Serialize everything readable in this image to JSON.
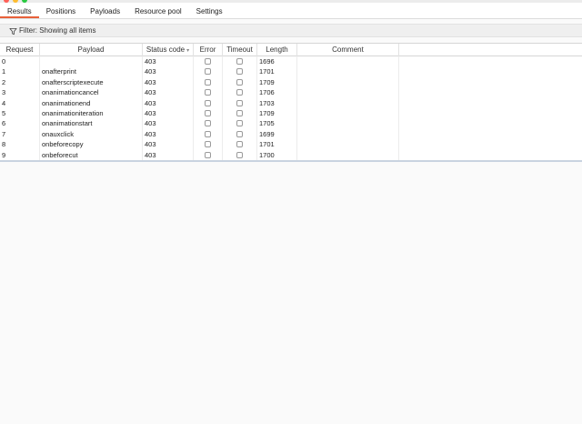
{
  "window": {
    "dot_colors": [
      "#ff5f57",
      "#febc2e",
      "#28c840"
    ]
  },
  "tabs": [
    {
      "label": "Results",
      "active": true
    },
    {
      "label": "Positions",
      "active": false
    },
    {
      "label": "Payloads",
      "active": false
    },
    {
      "label": "Resource pool",
      "active": false
    },
    {
      "label": "Settings",
      "active": false
    }
  ],
  "filter": {
    "label": "Filter: Showing all items"
  },
  "table": {
    "headers": {
      "request": "Request",
      "payload": "Payload",
      "status": "Status code",
      "error": "Error",
      "timeout": "Timeout",
      "length": "Length",
      "comment": "Comment"
    },
    "rows": [
      {
        "request": "0",
        "payload": "",
        "status": "403",
        "length": "1696"
      },
      {
        "request": "1",
        "payload": "onafterprint",
        "status": "403",
        "length": "1701"
      },
      {
        "request": "2",
        "payload": "onafterscriptexecute",
        "status": "403",
        "length": "1709"
      },
      {
        "request": "3",
        "payload": "onanimationcancel",
        "status": "403",
        "length": "1706"
      },
      {
        "request": "4",
        "payload": "onanimationend",
        "status": "403",
        "length": "1703"
      },
      {
        "request": "5",
        "payload": "onanimationiteration",
        "status": "403",
        "length": "1709"
      },
      {
        "request": "6",
        "payload": "onanimationstart",
        "status": "403",
        "length": "1705"
      },
      {
        "request": "7",
        "payload": "onauxclick",
        "status": "403",
        "length": "1699"
      },
      {
        "request": "8",
        "payload": "onbeforecopy",
        "status": "403",
        "length": "1701"
      },
      {
        "request": "9",
        "payload": "onbeforecut",
        "status": "403",
        "length": "1700"
      }
    ]
  },
  "colors": {
    "accent": "#e8613a"
  }
}
